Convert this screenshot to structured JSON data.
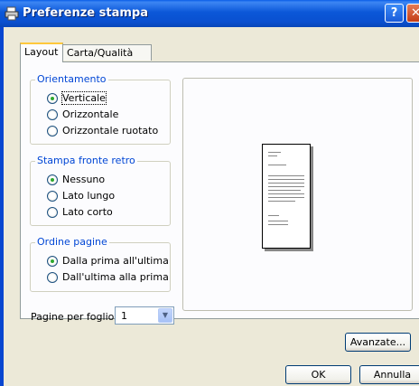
{
  "window": {
    "title": "Preferenze stampa"
  },
  "titlebar_buttons": {
    "help": "?",
    "close": "✕"
  },
  "tabs": [
    {
      "label": "Layout",
      "active": true
    },
    {
      "label": "Carta/Qualità",
      "active": false
    }
  ],
  "orientation": {
    "title": "Orientamento",
    "options": [
      "Verticale",
      "Orizzontale",
      "Orizzontale ruotato"
    ],
    "selected": "Verticale"
  },
  "duplex": {
    "title": "Stampa fronte retro",
    "options": [
      "Nessuno",
      "Lato lungo",
      "Lato corto"
    ],
    "selected": "Nessuno"
  },
  "page_order": {
    "title": "Ordine pagine",
    "options": [
      "Dalla prima all'ultima",
      "Dall'ultima alla prima"
    ],
    "selected": "Dalla prima all'ultima"
  },
  "pages_per_sheet": {
    "label": "Pagine per foglio:",
    "value": "1"
  },
  "buttons": {
    "advanced": "Avanzate...",
    "ok": "OK",
    "cancel": "Annulla"
  },
  "colors": {
    "accent": "#0046d5",
    "titlebar": "#0a57d8",
    "selected_dot": "#2fa82f"
  }
}
